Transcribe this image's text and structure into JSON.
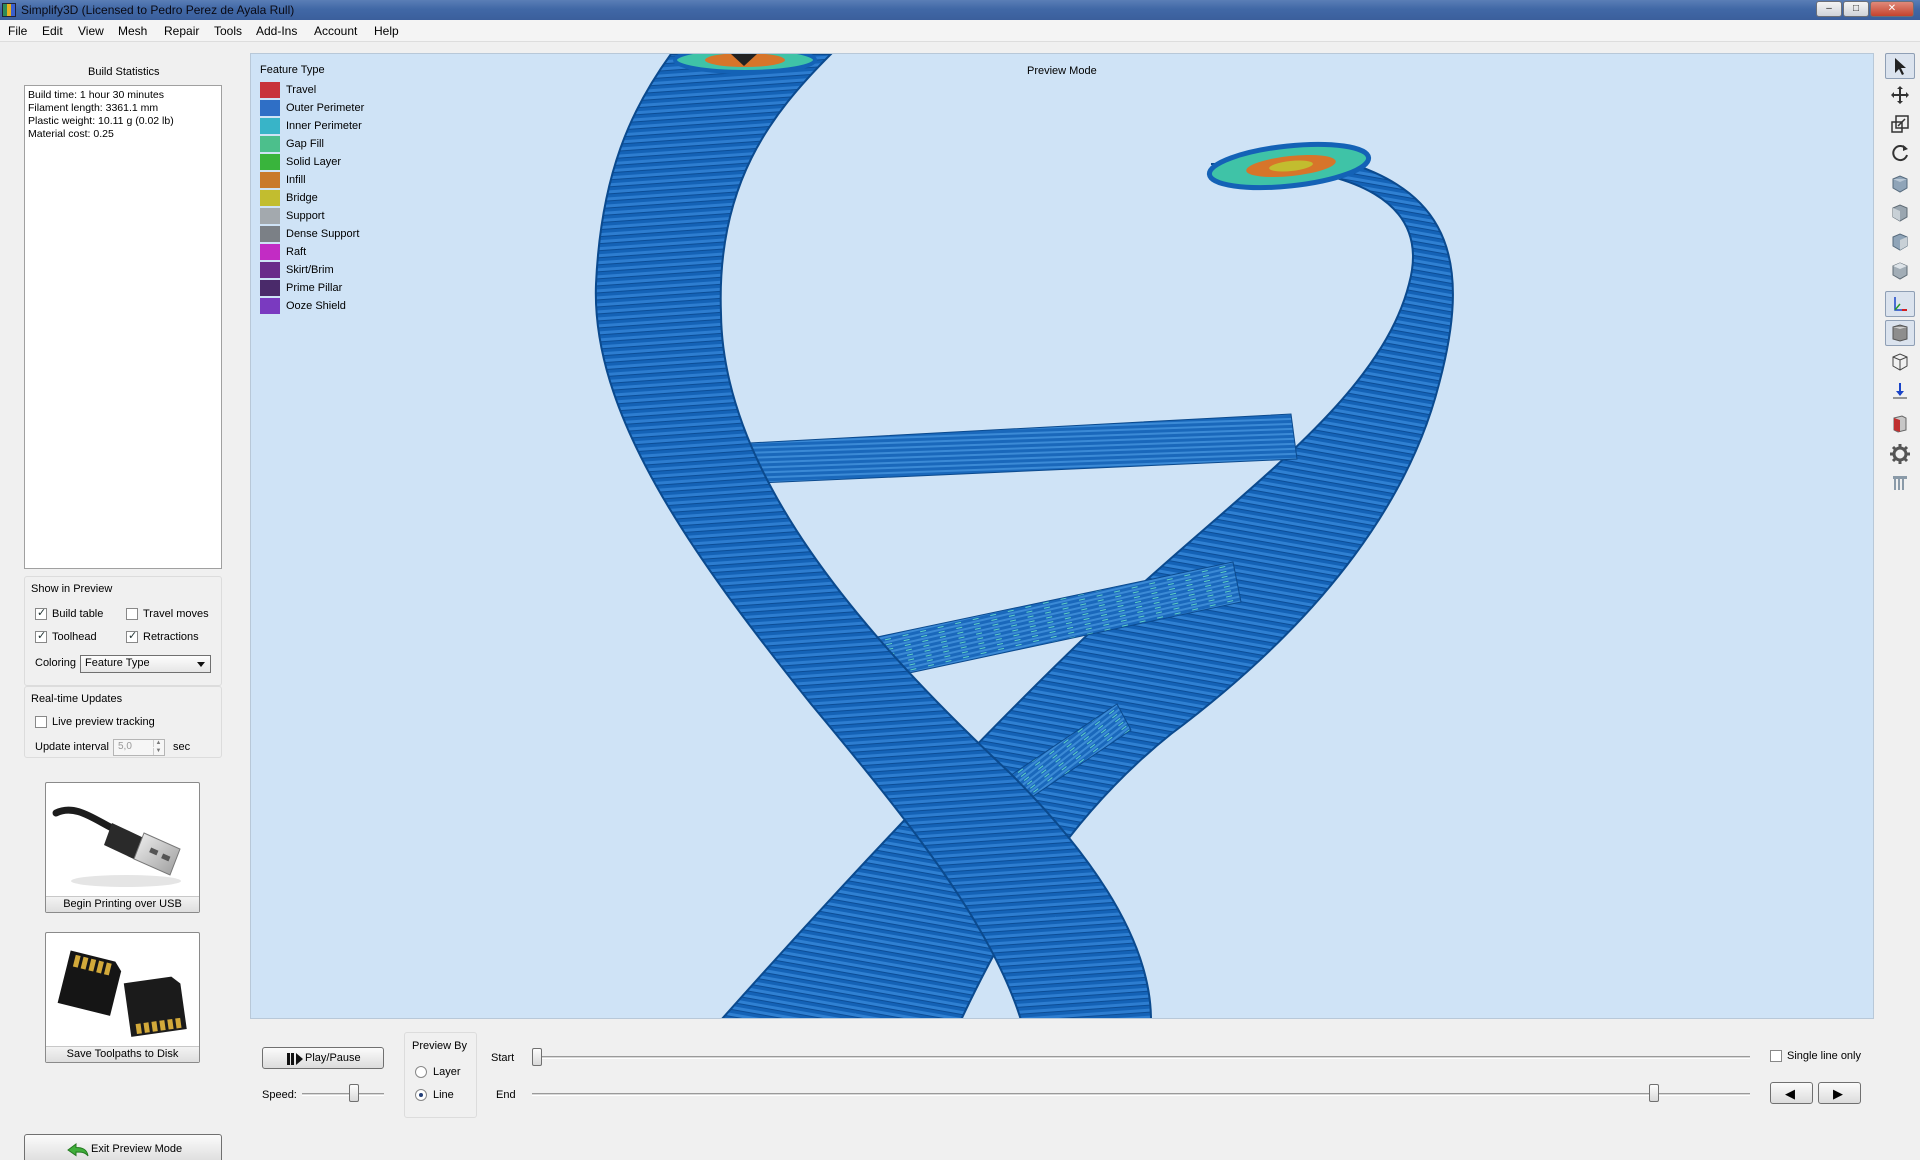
{
  "window": {
    "title": "Simplify3D (Licensed to Pedro Perez de Ayala Rull)",
    "minimize": "–",
    "maximize": "□",
    "close": "✕"
  },
  "menu": [
    "File",
    "Edit",
    "View",
    "Mesh",
    "Repair",
    "Tools",
    "Add-Ins",
    "Account",
    "Help"
  ],
  "build_statistics": {
    "title": "Build Statistics",
    "lines": [
      "Build time: 1 hour 30 minutes",
      "Filament length: 3361.1 mm",
      "Plastic weight: 10.11 g (0.02 lb)",
      "Material cost: 0.25"
    ]
  },
  "show_in_preview": {
    "title": "Show in Preview",
    "build_table": {
      "label": "Build table",
      "checked": true
    },
    "travel_moves": {
      "label": "Travel moves",
      "checked": false
    },
    "toolhead": {
      "label": "Toolhead",
      "checked": true
    },
    "retractions": {
      "label": "Retractions",
      "checked": true
    },
    "coloring_label": "Coloring",
    "coloring_value": "Feature Type"
  },
  "realtime_updates": {
    "title": "Real-time Updates",
    "live_preview": {
      "label": "Live preview tracking",
      "checked": false
    },
    "update_interval_label": "Update interval",
    "update_interval_value": "5,0",
    "unit": "sec"
  },
  "actions": {
    "usb_button": "Begin Printing over USB",
    "sd_button": "Save Toolpaths to Disk",
    "exit_preview": "Exit Preview Mode"
  },
  "viewport": {
    "legend_title": "Feature Type",
    "preview_mode_label": "Preview Mode",
    "legend": [
      {
        "label": "Travel",
        "color": "#c8323a"
      },
      {
        "label": "Outer Perimeter",
        "color": "#2f6fc6"
      },
      {
        "label": "Inner Perimeter",
        "color": "#38b4c8"
      },
      {
        "label": "Gap Fill",
        "color": "#4cbf8c"
      },
      {
        "label": "Solid Layer",
        "color": "#39b43c"
      },
      {
        "label": "Infill",
        "color": "#c97a2c"
      },
      {
        "label": "Bridge",
        "color": "#c2bd2f"
      },
      {
        "label": "Support",
        "color": "#a3a9ae"
      },
      {
        "label": "Dense Support",
        "color": "#7b8086"
      },
      {
        "label": "Raft",
        "color": "#c22cc4"
      },
      {
        "label": "Skirt/Brim",
        "color": "#6a2a8a"
      },
      {
        "label": "Prime Pillar",
        "color": "#4a2a6a"
      },
      {
        "label": "Ooze Shield",
        "color": "#7a3ac0"
      }
    ]
  },
  "toolbar_icons": [
    "select-icon",
    "move-icon",
    "scale-icon",
    "rotate-icon",
    "view-cube-icon",
    "view-cube-front-icon",
    "view-cube-side-icon",
    "view-cube-top-icon",
    "axes-icon",
    "solid-view-icon",
    "wireframe-icon",
    "toolhead-icon",
    "section-icon",
    "settings-gear-icon",
    "support-icon"
  ],
  "bottom": {
    "play_pause": "Play/Pause",
    "speed_label": "Speed:",
    "speed_level": 0.7,
    "preview_by_title": "Preview By",
    "layer_label": "Layer",
    "line_label": "Line",
    "selected_preview_by": "Line",
    "start_label": "Start",
    "end_label": "End",
    "start_position": 0,
    "end_position": 0.92,
    "single_line_only": {
      "label": "Single line only",
      "checked": false
    },
    "prev_icon": "◀",
    "next_icon": "▶"
  }
}
